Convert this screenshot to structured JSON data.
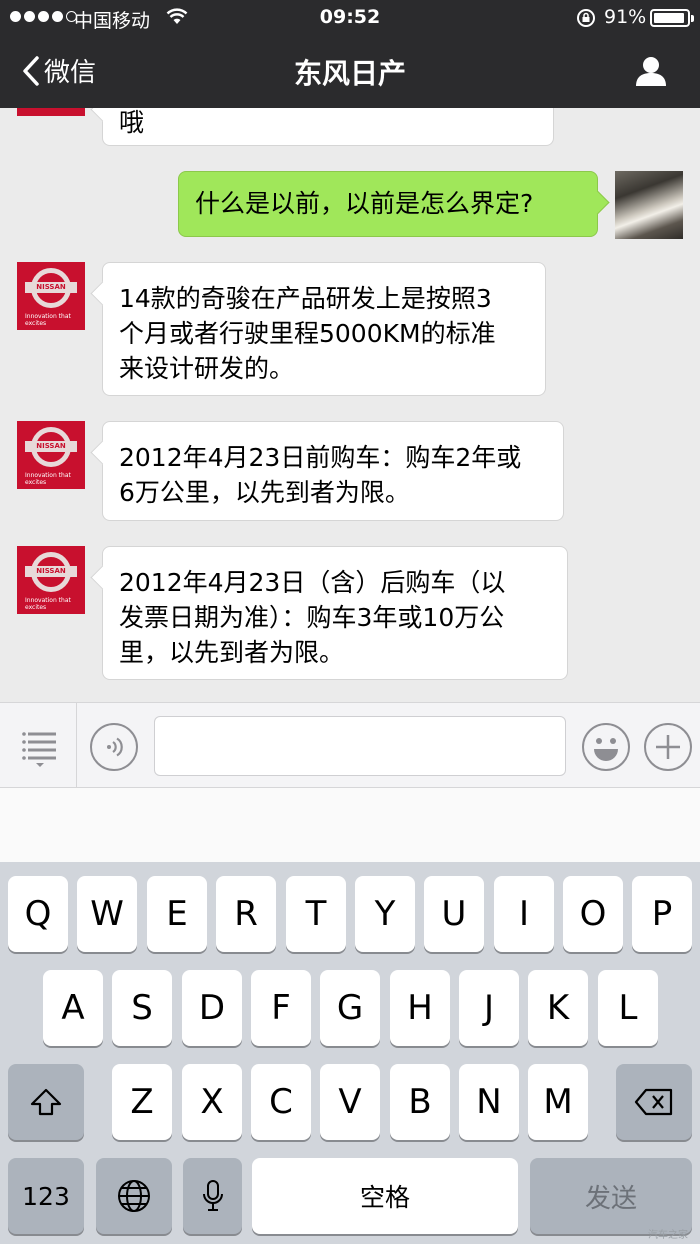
{
  "status_bar": {
    "carrier": "中国移动",
    "time": "09:52",
    "battery": "91%",
    "battery_level": 0.91
  },
  "nav": {
    "back_label": "微信",
    "title": "东风日产"
  },
  "avatar_brand": {
    "name": "NISSAN",
    "tagline": "Innovation that excites"
  },
  "messages": [
    {
      "from": "other",
      "text": "哦"
    },
    {
      "from": "me",
      "text": "什么是以前，以前是怎么界定?"
    },
    {
      "from": "other",
      "lines": [
        "14款的奇骏在产品研发上是按照3",
        "个月或者行驶里程5000KM的标准",
        "来设计研发的。"
      ]
    },
    {
      "from": "other",
      "lines": [
        "2012年4月23日前购车：购车2年或",
        "6万公里，以先到者为限。"
      ]
    },
    {
      "from": "other",
      "lines": [
        "2012年4月23日（含）后购车（以",
        "发票日期为准）：购车3年或10万公",
        "里，以先到者为限。"
      ]
    }
  ],
  "keyboard": {
    "row1": [
      "Q",
      "W",
      "E",
      "R",
      "T",
      "Y",
      "U",
      "I",
      "O",
      "P"
    ],
    "row2": [
      "A",
      "S",
      "D",
      "F",
      "G",
      "H",
      "J",
      "K",
      "L"
    ],
    "row3": [
      "Z",
      "X",
      "C",
      "V",
      "B",
      "N",
      "M"
    ],
    "numbers_key": "123",
    "space_key": "空格",
    "send_key": "发送"
  },
  "watermark": "汽车之家",
  "colors": {
    "navbar": "#2b2b2d",
    "my_bubble": "#a0e75a",
    "nissan_red": "#c8102e"
  }
}
